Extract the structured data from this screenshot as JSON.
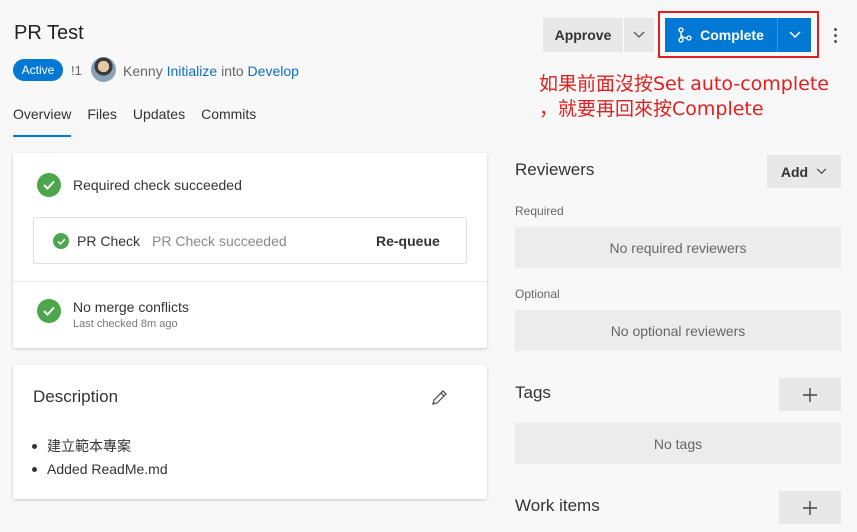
{
  "header": {
    "title": "PR Test",
    "status_badge": "Active",
    "pr_id": "!1",
    "author": "Kenny",
    "source_branch": "Initialize",
    "into_text": "into",
    "target_branch": "Develop"
  },
  "tabs": [
    {
      "label": "Overview",
      "active": true
    },
    {
      "label": "Files"
    },
    {
      "label": "Updates"
    },
    {
      "label": "Commits"
    }
  ],
  "actions": {
    "approve_label": "Approve",
    "complete_label": "Complete",
    "accent_color": "#0078d4"
  },
  "annotation": {
    "line1": "如果前面沒按Set auto-complete",
    "line2": "，就要再回來按Complete",
    "color": "#e02020"
  },
  "checks": {
    "required_check": "Required check succeeded",
    "pr_check_name": "PR Check",
    "pr_check_status": "PR Check succeeded",
    "requeue_label": "Re-queue",
    "merge_status": "No merge conflicts",
    "merge_checked": "Last checked 8m ago",
    "success_color": "#4ca64c"
  },
  "description": {
    "title": "Description",
    "items": [
      "建立範本專案",
      "Added ReadMe.md"
    ]
  },
  "reviewers": {
    "title": "Reviewers",
    "add_label": "Add",
    "required_label": "Required",
    "required_empty": "No required reviewers",
    "optional_label": "Optional",
    "optional_empty": "No optional reviewers"
  },
  "tags": {
    "title": "Tags",
    "empty": "No tags"
  },
  "work_items": {
    "title": "Work items"
  }
}
